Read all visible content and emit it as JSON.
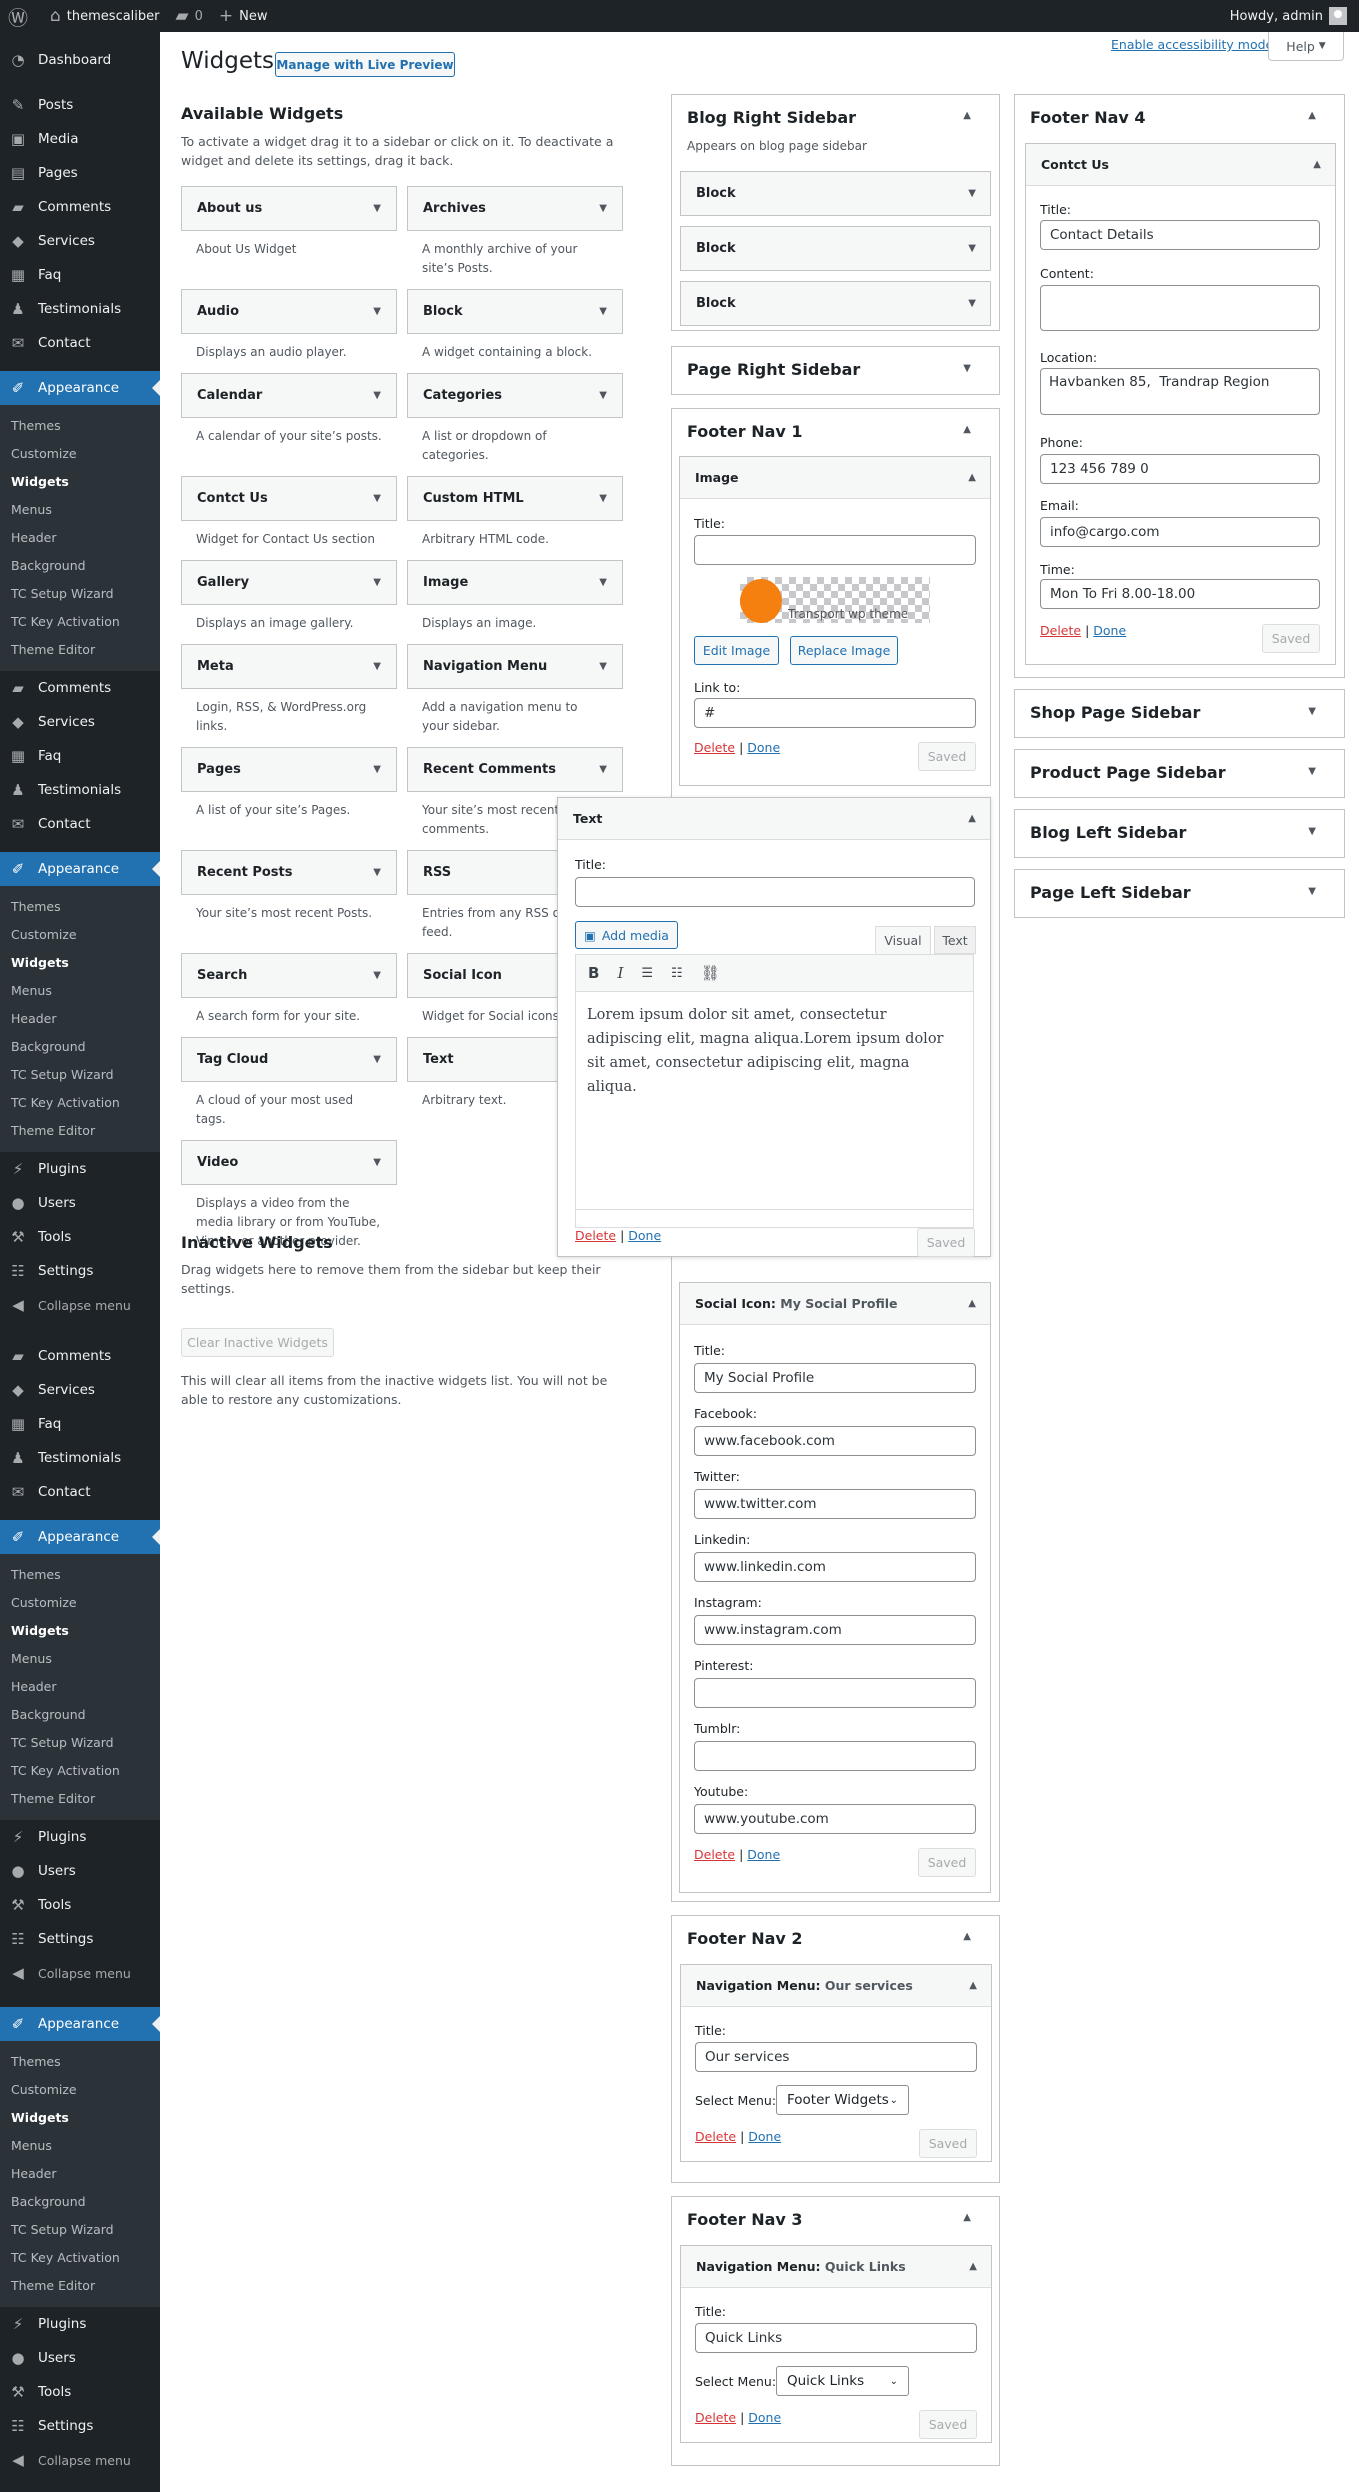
{
  "adminbar": {
    "site": "themescaliber",
    "comments": "0",
    "new": "New",
    "howdy": "Howdy, admin"
  },
  "menu": {
    "items": [
      {
        "t": "main",
        "label": "Dashboard",
        "icon": "◔"
      },
      {
        "t": "sep"
      },
      {
        "t": "main",
        "label": "Posts",
        "icon": "✎"
      },
      {
        "t": "main",
        "label": "Media",
        "icon": "▣"
      },
      {
        "t": "main",
        "label": "Pages",
        "icon": "▤"
      },
      {
        "t": "main",
        "label": "Comments",
        "icon": "▰"
      },
      {
        "t": "main",
        "label": "Services",
        "icon": "◆"
      },
      {
        "t": "main",
        "label": "Faq",
        "icon": "▦"
      },
      {
        "t": "main",
        "label": "Testimonials",
        "icon": "♟"
      },
      {
        "t": "main",
        "label": "Contact",
        "icon": "✉"
      },
      {
        "t": "sep"
      },
      {
        "t": "app",
        "label": "Appearance",
        "icon": "✐"
      },
      {
        "t": "main",
        "label": "Comments",
        "icon": "▰"
      },
      {
        "t": "main",
        "label": "Services",
        "icon": "◆"
      },
      {
        "t": "main",
        "label": "Faq",
        "icon": "▦"
      },
      {
        "t": "main",
        "label": "Testimonials",
        "icon": "♟"
      },
      {
        "t": "main",
        "label": "Contact",
        "icon": "✉"
      },
      {
        "t": "sep"
      },
      {
        "t": "app",
        "label": "Appearance",
        "icon": "✐"
      },
      {
        "t": "main",
        "label": "Plugins",
        "icon": "⚡"
      },
      {
        "t": "main",
        "label": "Users",
        "icon": "●"
      },
      {
        "t": "main",
        "label": "Tools",
        "icon": "⚒"
      },
      {
        "t": "main",
        "label": "Settings",
        "icon": "☷"
      },
      {
        "t": "col",
        "label": "Collapse menu",
        "icon": "◀"
      },
      {
        "t": "gap"
      },
      {
        "t": "main",
        "label": "Comments",
        "icon": "▰"
      },
      {
        "t": "main",
        "label": "Services",
        "icon": "◆"
      },
      {
        "t": "main",
        "label": "Faq",
        "icon": "▦"
      },
      {
        "t": "main",
        "label": "Testimonials",
        "icon": "♟"
      },
      {
        "t": "main",
        "label": "Contact",
        "icon": "✉"
      },
      {
        "t": "sep"
      },
      {
        "t": "app",
        "label": "Appearance",
        "icon": "✐"
      },
      {
        "t": "main",
        "label": "Plugins",
        "icon": "⚡"
      },
      {
        "t": "main",
        "label": "Users",
        "icon": "●"
      },
      {
        "t": "main",
        "label": "Tools",
        "icon": "⚒"
      },
      {
        "t": "main",
        "label": "Settings",
        "icon": "☷"
      },
      {
        "t": "col",
        "label": "Collapse menu",
        "icon": "◀"
      },
      {
        "t": "gap"
      },
      {
        "t": "app",
        "label": "Appearance",
        "icon": "✐"
      },
      {
        "t": "main",
        "label": "Plugins",
        "icon": "⚡"
      },
      {
        "t": "main",
        "label": "Users",
        "icon": "●"
      },
      {
        "t": "main",
        "label": "Tools",
        "icon": "⚒"
      },
      {
        "t": "main",
        "label": "Settings",
        "icon": "☷"
      },
      {
        "t": "col",
        "label": "Collapse menu",
        "icon": "◀"
      }
    ],
    "appearance_sub": [
      "Themes",
      "Customize",
      "Widgets",
      "Menus",
      "Header",
      "Background",
      "TC Setup Wizard",
      "TC Key Activation",
      "Theme Editor"
    ],
    "current_sub": "Widgets"
  },
  "header": {
    "title": "Widgets",
    "live_preview": "Manage with Live Preview",
    "accessibility": "Enable accessibility mode",
    "help": "Help"
  },
  "available": {
    "title": "Available Widgets",
    "desc": "To activate a widget drag it to a sidebar or click on it. To deactivate a widget and delete its settings, drag it back.",
    "widgets": [
      {
        "name": "About us",
        "desc": "About Us Widget"
      },
      {
        "name": "Archives",
        "desc": "A monthly archive of your site’s Posts."
      },
      {
        "name": "Audio",
        "desc": "Displays an audio player."
      },
      {
        "name": "Block",
        "desc": "A widget containing a block."
      },
      {
        "name": "Calendar",
        "desc": "A calendar of your site’s posts."
      },
      {
        "name": "Categories",
        "desc": "A list or dropdown of categories."
      },
      {
        "name": "Contct Us",
        "desc": "Widget for Contact Us section"
      },
      {
        "name": "Custom HTML",
        "desc": "Arbitrary HTML code."
      },
      {
        "name": "Gallery",
        "desc": "Displays an image gallery."
      },
      {
        "name": "Image",
        "desc": "Displays an image."
      },
      {
        "name": "Meta",
        "desc": "Login, RSS, & WordPress.org links."
      },
      {
        "name": "Navigation Menu",
        "desc": "Add a navigation menu to your sidebar."
      },
      {
        "name": "Pages",
        "desc": "A list of your site’s Pages."
      },
      {
        "name": "Recent Comments",
        "desc": "Your site’s most recent comments."
      },
      {
        "name": "Recent Posts",
        "desc": "Your site’s most recent Posts."
      },
      {
        "name": "RSS",
        "desc": "Entries from any RSS or Atom feed."
      },
      {
        "name": "Search",
        "desc": "A search form for your site."
      },
      {
        "name": "Social Icon",
        "desc": "Widget for Social icons section"
      },
      {
        "name": "Tag Cloud",
        "desc": "A cloud of your most used tags."
      },
      {
        "name": "Text",
        "desc": "Arbitrary text."
      },
      {
        "name": "Video",
        "desc": "Displays a video from the media library or from YouTube, Vimeo, or another provider."
      }
    ]
  },
  "inactive": {
    "title": "Inactive Widgets",
    "desc": "Drag widgets here to remove them from the sidebar but keep their settings.",
    "clear": "Clear Inactive Widgets",
    "note": "This will clear all items from the inactive widgets list. You will not be able to restore any customizations."
  },
  "common": {
    "delete": "Delete",
    "sep": "|",
    "done": "Done",
    "saved": "Saved",
    "title_label": "Title:",
    "select_menu": "Select Menu:"
  },
  "blog_right": {
    "title": "Blog Right Sidebar",
    "desc": "Appears on blog page sidebar",
    "blocks": [
      "Block",
      "Block",
      "Block"
    ]
  },
  "page_right": {
    "title": "Page Right Sidebar"
  },
  "footer1": {
    "title": "Footer Nav 1",
    "image": {
      "name": "Image",
      "title": "",
      "logo_text": "Transport wp theme",
      "edit": "Edit Image",
      "replace": "Replace Image",
      "link_label": "Link to:",
      "link": "#"
    },
    "social": {
      "name": "Social Icon",
      "instance": "My Social Profile",
      "fields": [
        {
          "label": "Title:",
          "value": "My Social Profile"
        },
        {
          "label": "Facebook:",
          "value": "www.facebook.com"
        },
        {
          "label": "Twitter:",
          "value": "www.twitter.com"
        },
        {
          "label": "Linkedin:",
          "value": "www.linkedin.com"
        },
        {
          "label": "Instagram:",
          "value": "www.instagram.com"
        },
        {
          "label": "Pinterest:",
          "value": ""
        },
        {
          "label": "Tumblr:",
          "value": ""
        },
        {
          "label": "Youtube:",
          "value": "www.youtube.com"
        }
      ]
    }
  },
  "text_widget": {
    "name": "Text",
    "title": "",
    "add_media": "Add media",
    "tab_visual": "Visual",
    "tab_text": "Text",
    "content": "Lorem ipsum dolor sit amet, consectetur adipiscing elit, magna aliqua.Lorem ipsum dolor sit amet, consectetur adipiscing elit, magna aliqua."
  },
  "footer2": {
    "title": "Footer Nav 2",
    "widget": "Navigation Menu",
    "instance": "Our services",
    "title_value": "Our services",
    "menu": "Footer Widgets"
  },
  "footer3": {
    "title": "Footer Nav 3",
    "widget": "Navigation Menu",
    "instance": "Quick Links",
    "title_value": "Quick Links",
    "menu": "Quick Links"
  },
  "footer4": {
    "title": "Footer Nav 4",
    "widget": "Contct Us",
    "title_value": "Contact Details",
    "content_label": "Content:",
    "content": "",
    "location_label": "Location:",
    "location": "Havbanken 85,  Trandrap Region",
    "phone_label": "Phone:",
    "phone": "123 456 789 0",
    "email_label": "Email:",
    "email": "info@cargo.com",
    "time_label": "Time:",
    "time": "Mon To Fri 8.00-18.00"
  },
  "other_sidebars": [
    "Shop Page Sidebar",
    "Product Page Sidebar",
    "Blog Left Sidebar",
    "Page Left Sidebar"
  ],
  "colors": {
    "accent": "#2271b1",
    "menu_bg": "#1d2327",
    "delete": "#d63638"
  }
}
